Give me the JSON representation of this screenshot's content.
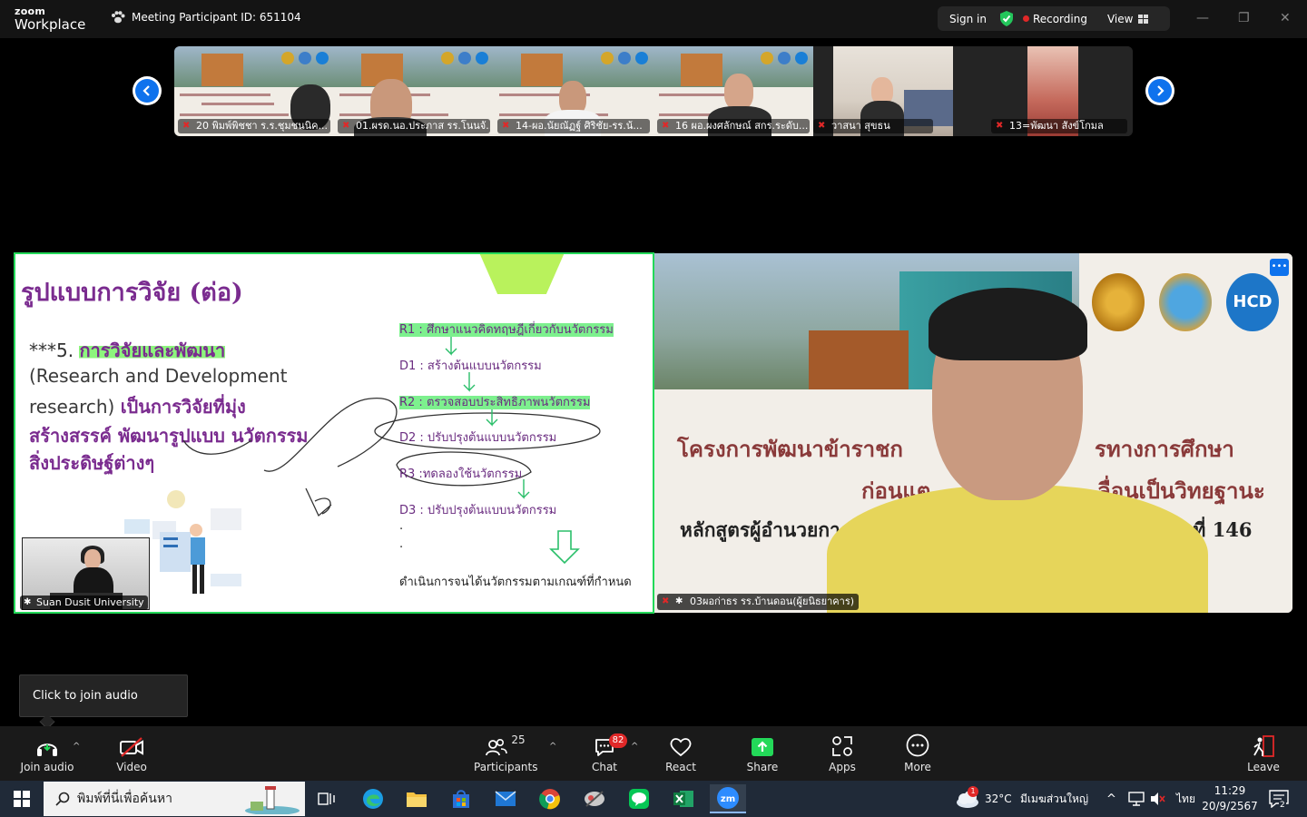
{
  "titlebar": {
    "brand_top": "zoom",
    "brand_bottom": "Workplace",
    "meeting_id": "Meeting Participant ID: 651104",
    "sign_in": "Sign in",
    "recording": "Recording",
    "view": "View",
    "minimize": "—",
    "restore": "❐",
    "close": "✕"
  },
  "filmstrip": {
    "prev_icon": "chevron-left-icon",
    "next_icon": "chevron-right-icon",
    "participants": [
      {
        "name": "20 พิมพ์พิชชา ร.ร.ชุมชนนิค..."
      },
      {
        "name": "01.ผรด.นอ.ประภาส รร.โนนจั..."
      },
      {
        "name": "14-ผอ.นัยณัฏฐ์ ศิริชัย-รร.น้..."
      },
      {
        "name": "16 ผอ.ผงศลักษณ์ สกร.ระดับ..."
      },
      {
        "name": "วาสนา สุขธน"
      },
      {
        "name": "13=พัฒนา สังข์โกมล"
      }
    ]
  },
  "slide": {
    "title": "รูปแบบการวิจัย (ต่อ)",
    "point_prefix": "***5.",
    "point_head": "การวิจัยและพัฒนา",
    "line2": "(Research and Development",
    "line3a": "research)",
    "line3b": "เป็นการวิจัยที่มุ่ง",
    "line4": "สร้างสรรค์ พัฒนารูปแบบ นวัตกรรม",
    "line5": "สิ่งประดิษฐ์ต่างๆ",
    "steps": [
      "R1 : ศึกษาแนวคิดทฤษฎีเกี่ยวกับนวัตกรรม",
      "D1 : สร้างต้นแบบนวัตกรรม",
      "R2 : ตรวจสอบประสิทธิภาพนวัตกรรม",
      "D2 : ปรับปรุงต้นแบบนวัตกรรม",
      "R3 :ทดลองใช้นวัตกรรม",
      "D3 : ปรับปรุงต้นแบบนวัตกรรม",
      ".",
      ".",
      "ดำเนินการจนได้นวัตกรรมตามเกณฑ์ที่กำหนด"
    ],
    "presenter_name": "Suan Dusit University"
  },
  "speaker": {
    "banner1": "โครงการพัฒนาข้าราชก",
    "banner1b": "รทางการศึกษา",
    "banner2": "ก่อนแต",
    "banner2b": "ลื่อนเป็นวิทยฐานะ",
    "banner3": "หลักสูตรผู้อำนวยการและ",
    "banner3b": "ชำนาญ ระยะที่ 146",
    "logo_text": "HCD",
    "name": "03ผอก่าธร รร.บ้านดอน(ผู้ยนิธยาคาร)",
    "more": "•••"
  },
  "tooltip": {
    "text": "Click to join audio"
  },
  "toolbar": {
    "join_audio": "Join audio",
    "video": "Video",
    "participants": "Participants",
    "participants_count": "25",
    "chat": "Chat",
    "chat_badge": "82",
    "react": "React",
    "share": "Share",
    "apps": "Apps",
    "more": "More",
    "leave": "Leave"
  },
  "taskbar": {
    "search_placeholder": "พิมพ์ที่นี่เพื่อค้นหา",
    "weather": "32°C",
    "weather_desc": "มีเมฆส่วนใหญ่",
    "weather_badge": "1",
    "lang": "ไทย",
    "time": "11:29",
    "date": "20/9/2567",
    "notif_count": "2"
  },
  "colors": {
    "accent": "#0e72ed",
    "share_border": "#23d959",
    "record_red": "#e02828"
  }
}
